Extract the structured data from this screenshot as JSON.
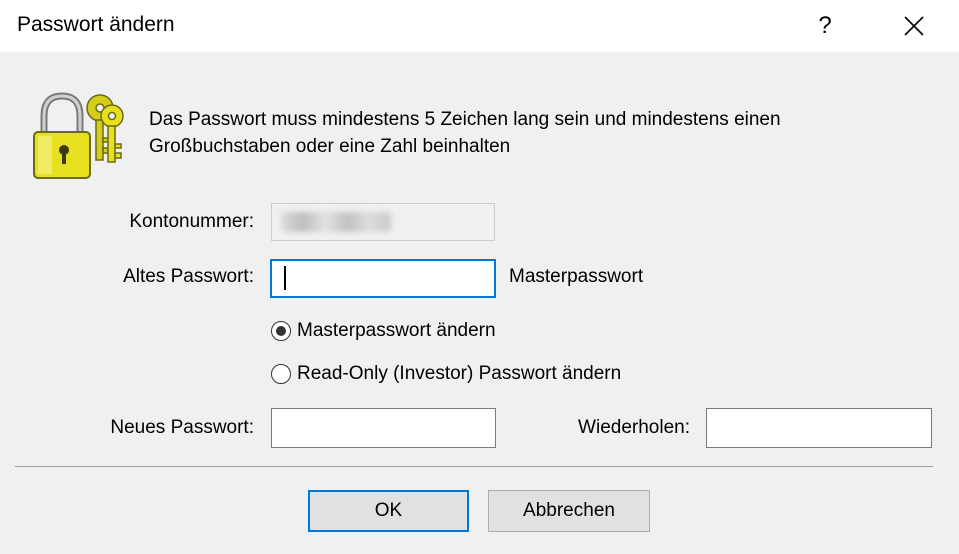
{
  "window": {
    "title": "Passwort ändern",
    "help_glyph": "?"
  },
  "icons": {
    "lock": "padlock-with-keys-icon",
    "close": "close-icon"
  },
  "description": "Das Passwort muss mindestens 5 Zeichen lang sein und mindestens einen Großbuchstaben oder eine Zahl beinhalten",
  "form": {
    "account_label": "Kontonummer:",
    "account_value": "",
    "old_password_label": "Altes Passwort:",
    "old_password_value": "",
    "password_type_label": "Masterpasswort",
    "radio_options": [
      {
        "label": "Masterpasswort ändern",
        "checked": true
      },
      {
        "label": "Read-Only (Investor) Passwort ändern",
        "checked": false
      }
    ],
    "new_password_label": "Neues Passwort:",
    "new_password_value": "",
    "repeat_label": "Wiederholen:",
    "repeat_value": ""
  },
  "buttons": {
    "ok": "OK",
    "cancel": "Abbrechen"
  },
  "colors": {
    "accent": "#0078d7",
    "dialog_background": "#f0f0f0",
    "lock_yellow": "#e6e01e"
  }
}
